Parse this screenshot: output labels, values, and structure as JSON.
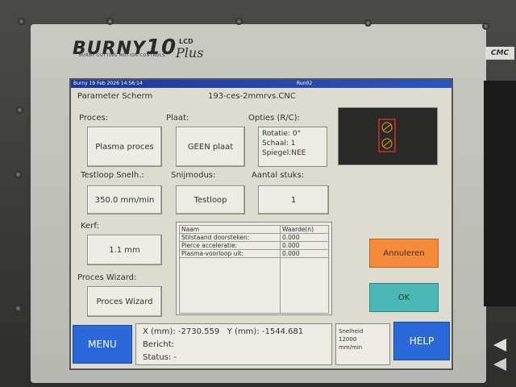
{
  "device": {
    "brand": "BURNY",
    "model_number": "10",
    "model_lcd": "LCD",
    "model_plus": "Plus",
    "brand_tagline": "BURNY CUTTING MOTION CONTROLS",
    "side_tag": "CMC"
  },
  "titlebar": {
    "left": "Burny    19 Feb 2026  14:56:14",
    "right": "Run02"
  },
  "header": {
    "screen_title": "Parameter Scherm",
    "filename": "193-ces-2mmrvs.CNC"
  },
  "proces": {
    "label": "Proces:",
    "value": "Plasma proces"
  },
  "plaat": {
    "label": "Plaat:",
    "value": "GEEN plaat"
  },
  "opties": {
    "label": "Opties (R/C):",
    "rotatie": "Rotatie: 0°",
    "schaal": "Schaal: 1",
    "spiegel": "Spiegel:NEE"
  },
  "testloop_snelh": {
    "label": "Testloop Snelh.:",
    "value": "350.0 mm/min"
  },
  "snijmodus": {
    "label": "Snijmodus:",
    "value": "Testloop"
  },
  "aantal_stuks": {
    "label": "Aantal stuks:",
    "value": "1"
  },
  "kerf": {
    "label": "Kerf:",
    "value": "1.1 mm"
  },
  "proces_wizard": {
    "label": "Proces Wizard:",
    "value": "Proces Wizard"
  },
  "param_table": {
    "headers": [
      "Naam",
      "Waarde(n)"
    ],
    "rows": [
      [
        "Stilstaand doorsteken:",
        "0.000"
      ],
      [
        "Pierce acceleratie:",
        "0.000"
      ],
      [
        "Plasma-voorloop uit:",
        "0.000"
      ]
    ]
  },
  "buttons": {
    "annuleren": "Annuleren",
    "ok": "OK",
    "menu": "MENU",
    "help": "HELP"
  },
  "status": {
    "x_label": "X (mm):",
    "x_value": "-2730.559",
    "y_label": "Y (mm):",
    "y_value": "-1544.681",
    "bericht": "Bericht:",
    "status": "Status:  -"
  },
  "speed": {
    "label": "Snelheid",
    "value": "12000",
    "unit": "mm/min"
  },
  "colors": {
    "titlebar": "#1a3a9a",
    "annuleren": "#f58a3a",
    "ok": "#4ab8b4",
    "blue_buttons": "#2a6ad8"
  }
}
